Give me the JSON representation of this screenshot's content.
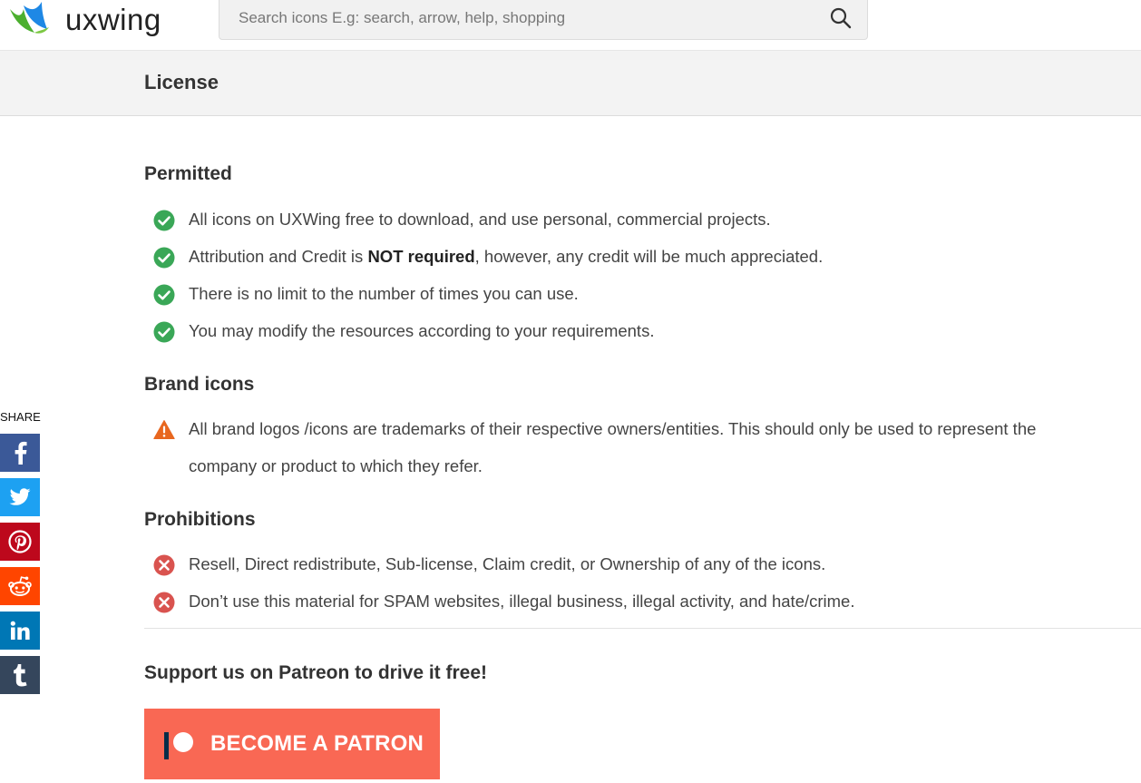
{
  "header": {
    "logo_text": "uxwing",
    "search": {
      "placeholder": "Search icons E.g: search, arrow, help, shopping",
      "value": ""
    }
  },
  "section": {
    "title": "License"
  },
  "permitted": {
    "heading": "Permitted",
    "items": [
      {
        "text": "All icons on UXWing free to download, and use personal, commercial projects."
      },
      {
        "pre": "Attribution and Credit is ",
        "bold": "NOT required",
        "post": ", however, any credit will be much appreciated."
      },
      {
        "text": "There is no limit to the number of times you can use."
      },
      {
        "text": "You may modify the resources according to your requirements."
      }
    ]
  },
  "brand": {
    "heading": "Brand icons",
    "items": [
      {
        "line1": "All brand logos /icons are trademarks of their respective owners/entities. This should only be used to represent the",
        "line2": "company or product to which they refer."
      }
    ]
  },
  "prohibitions": {
    "heading": "Prohibitions",
    "items": [
      {
        "text": "Resell, Direct redistribute, Sub-license, Claim credit, or Ownership of any of the icons."
      },
      {
        "text": "Don’t use this material for SPAM websites, illegal business, illegal activity, and hate/crime."
      }
    ]
  },
  "support": {
    "heading": "Support us on Patreon to drive it free!",
    "button_label": "BECOME A PATRON"
  },
  "share": {
    "label": "SHARE",
    "buttons": [
      {
        "name": "facebook",
        "icon": "facebook-icon",
        "color": "#3b5998"
      },
      {
        "name": "twitter",
        "icon": "twitter-icon",
        "color": "#1da1f2"
      },
      {
        "name": "pinterest",
        "icon": "pinterest-icon",
        "color": "#bd081c"
      },
      {
        "name": "reddit",
        "icon": "reddit-icon",
        "color": "#ff4500"
      },
      {
        "name": "linkedin",
        "icon": "linkedin-icon",
        "color": "#0077b5"
      },
      {
        "name": "tumblr",
        "icon": "tumblr-icon",
        "color": "#35465c"
      }
    ]
  },
  "colors": {
    "check": "#3aa757",
    "warning": "#e8671f",
    "prohibit": "#d9534f",
    "patron": "#f96854",
    "logo_green": "#4caf2f",
    "logo_blue": "#1e88e5"
  }
}
